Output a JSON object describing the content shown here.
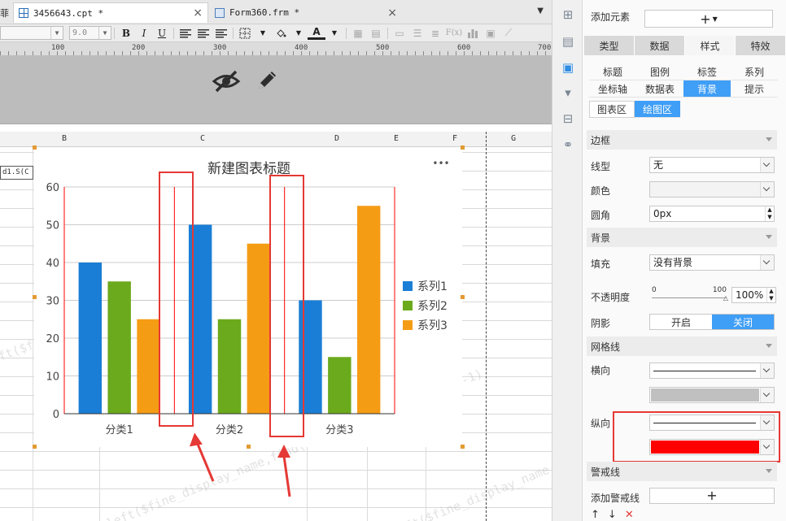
{
  "tabs": [
    {
      "label": "3456643.cpt *",
      "close": "×",
      "icon": "report-file-icon"
    },
    {
      "label": "Form360.frm *",
      "close": "×",
      "icon": "form-file-icon"
    }
  ],
  "tab_left_fragment": "菲",
  "toolbar": {
    "font_size": "9.0",
    "bold": "B",
    "italic": "I",
    "underline": "U",
    "fx_label": "F(x)"
  },
  "ruler": {
    "marks": [
      "100",
      "200",
      "300",
      "400",
      "500",
      "600",
      "700"
    ]
  },
  "columns": [
    "B",
    "C",
    "D",
    "E",
    "F",
    "G"
  ],
  "cell_fragment": "d1.S(C",
  "watermark_text": "=left($fine_display_name,find(\"(\",$fine_display_name)-1)",
  "chart_data": {
    "type": "bar",
    "title": "新建图表标题",
    "categories": [
      "分类1",
      "分类2",
      "分类3"
    ],
    "series": [
      {
        "name": "系列1",
        "values": [
          40,
          50,
          30
        ],
        "color": "#1a7ed6"
      },
      {
        "name": "系列2",
        "values": [
          35,
          25,
          15
        ],
        "color": "#6aaa1c"
      },
      {
        "name": "系列3",
        "values": [
          25,
          45,
          55
        ],
        "color": "#f59c15"
      }
    ],
    "ylim": [
      0,
      60
    ],
    "yticks": [
      "0",
      "10",
      "20",
      "30",
      "40",
      "50",
      "60"
    ],
    "horizontal_grid": true,
    "horizontal_grid_color": "#cccccc",
    "vertical_grid": true,
    "vertical_grid_color": "#ff0000",
    "legend_position": "right",
    "more_button": "•••"
  },
  "panel": {
    "add_element_label": "添加元素",
    "add_symbol": "+",
    "top_tabs": [
      "类型",
      "数据",
      "样式",
      "特效"
    ],
    "active_top_tab": "样式",
    "sub_tabs_row1": [
      "标题",
      "图例",
      "标签",
      "系列"
    ],
    "sub_tabs_row2": [
      "坐标轴",
      "数据表",
      "背景",
      "提示"
    ],
    "area_tabs": [
      "图表区",
      "绘图区"
    ],
    "border_section": "边框",
    "line_type_label": "线型",
    "line_type_value": "无",
    "color_label": "颜色",
    "corner_label": "圆角",
    "corner_value": "0px",
    "background_section": "背景",
    "fill_label": "填充",
    "fill_value": "没有背景",
    "opacity_label": "不透明度",
    "opacity_min": "0",
    "opacity_max": "100",
    "opacity_value": "100%",
    "shadow_label": "阴影",
    "shadow_on": "开启",
    "shadow_off": "关闭",
    "gridline_section": "网格线",
    "horizontal_label": "横向",
    "vertical_label": "纵向",
    "vertical_color": "#ff0000",
    "horizontal_line_color": "#c0c0c0",
    "warning_section": "警戒线",
    "add_warning_label": "添加警戒线"
  }
}
